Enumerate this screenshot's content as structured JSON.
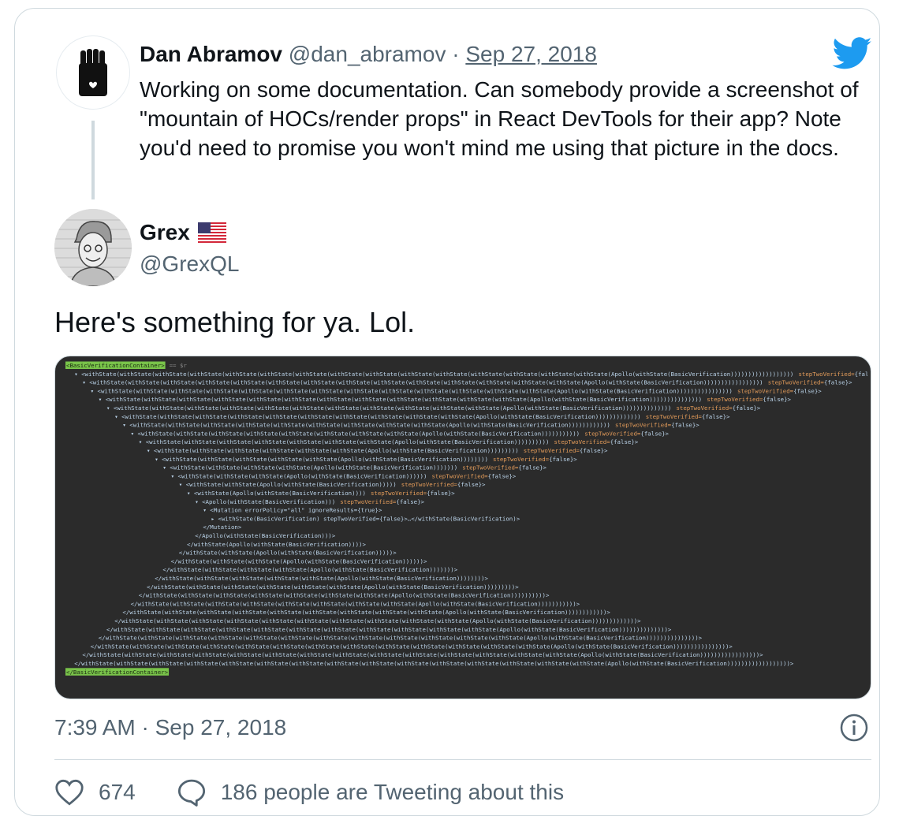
{
  "quoted": {
    "name": "Dan Abramov",
    "handle": "@dan_abramov",
    "separator": "·",
    "date": "Sep 27, 2018",
    "text": "Working on some documentation. Can somebody provide a screenshot of \"mountain of HOCs/render props\" in React DevTools for their app? Note you'd need to promise you won't mind me using that picture in the docs."
  },
  "reply": {
    "name": "Grex",
    "flag_icon": "us-flag-icon",
    "handle": "@GrexQL",
    "text": "Here's something for ya. Lol."
  },
  "media": {
    "top_tag": "BasicVerificationContainer",
    "top_suffix": "== $r",
    "bottom_tag": "BasicVerificationContainer",
    "prop_name": "stepTwoVerified",
    "prop_value": "{false}",
    "mutation_line": "Mutation errorPolicy=\"all\" ignoreResults={true}",
    "inner_line": "withState(BasicVerification) stepTwoVerified={false}>…</withState(BasicVerification)>",
    "mutation_close": "</Mutation>",
    "wrapper": "withState",
    "apollo": "Apollo",
    "core": "BasicVerification",
    "depth": 16
  },
  "meta": {
    "time": "7:39 AM",
    "separator": "·",
    "date": "Sep 27, 2018"
  },
  "actions": {
    "like_count": "674",
    "reply_text": "186 people are Tweeting about this"
  },
  "colors": {
    "twitter_blue": "#1d9bf0",
    "border": "#cfd9de",
    "muted": "#536471",
    "devtools_bg": "#2b2b2b",
    "devtools_text": "#bcd5eb",
    "devtools_attr": "#e49c5a",
    "devtools_highlight": "#79c34a"
  }
}
